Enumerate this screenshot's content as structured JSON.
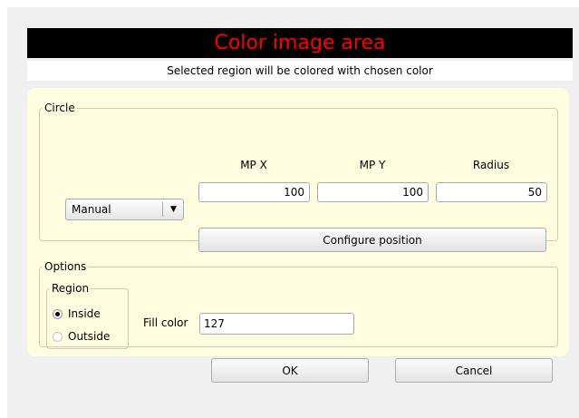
{
  "header": {
    "title": "Color image area",
    "subtitle": "Selected region will be colored with chosen color"
  },
  "circle_group": {
    "legend": "Circle",
    "mode": {
      "selected": "Manual",
      "arrow_icon": "dropdown-arrow-icon"
    },
    "columns": [
      {
        "label": "MP X",
        "value": "100"
      },
      {
        "label": "MP Y",
        "value": "100"
      },
      {
        "label": "Radius",
        "value": "50"
      }
    ],
    "configure_label": "Configure position"
  },
  "options_group": {
    "legend": "Options",
    "region": {
      "legend": "Region",
      "options": [
        {
          "label": "Inside",
          "checked": true
        },
        {
          "label": "Outside",
          "checked": false
        }
      ]
    },
    "fill_color": {
      "label": "Fill color",
      "value": "127"
    }
  },
  "footer": {
    "ok_label": "OK",
    "cancel_label": "Cancel"
  },
  "colors": {
    "title_bg": "#000000",
    "title_text": "#ff0000",
    "panel_bg": "#fffce0",
    "dialog_bg": "#f0f0f0"
  }
}
